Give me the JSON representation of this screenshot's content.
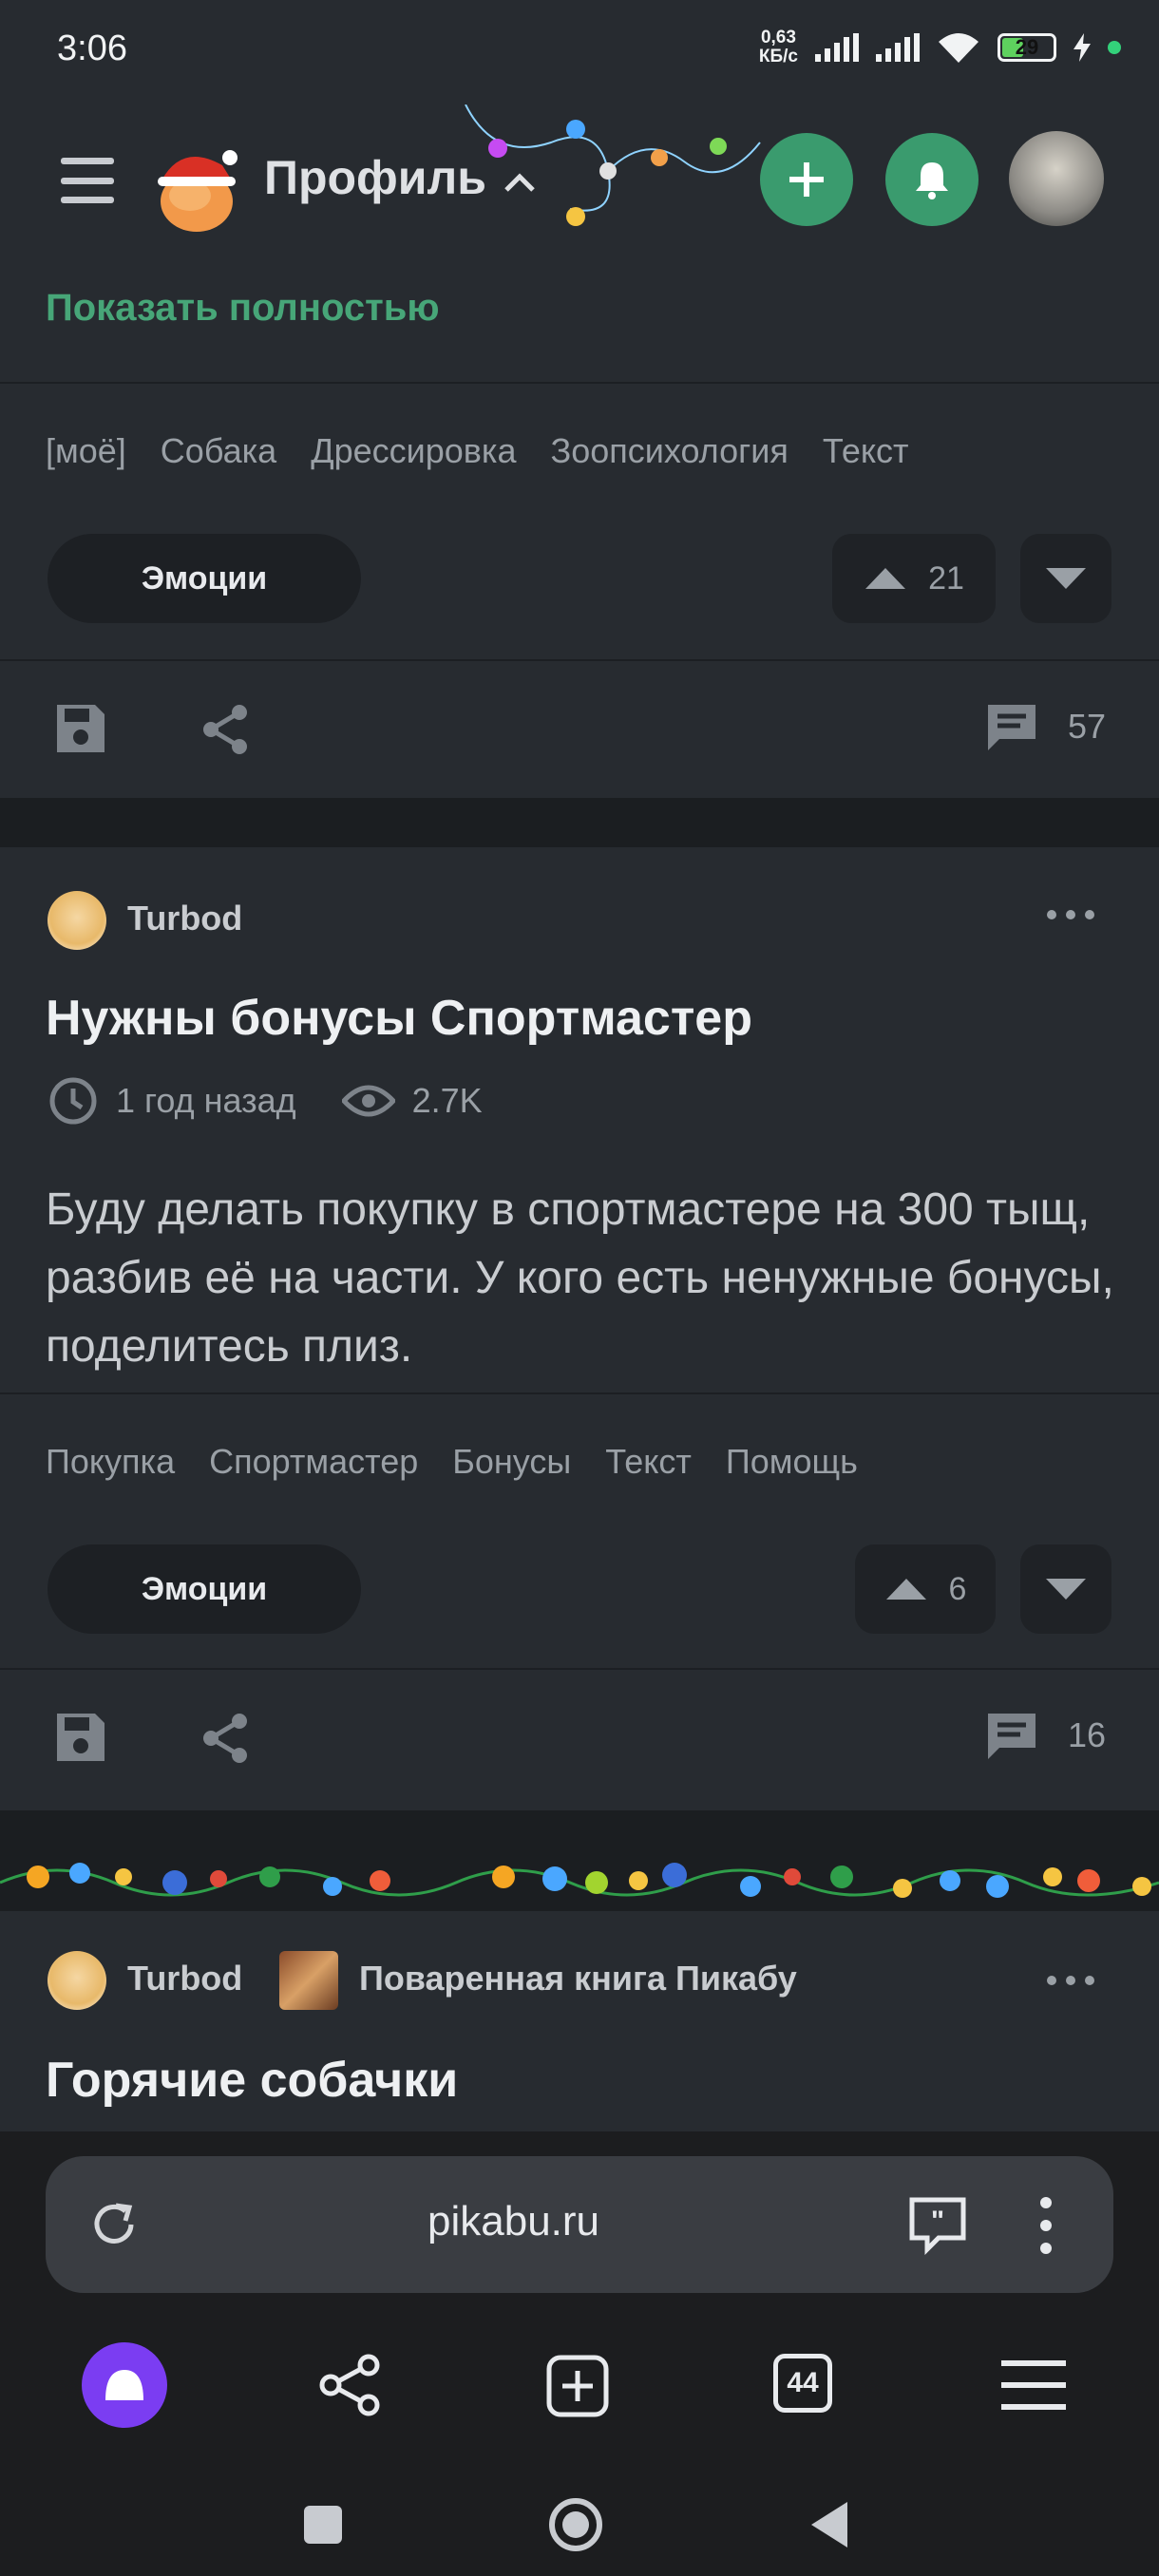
{
  "status_bar": {
    "time": "3:06",
    "net_speed_value": "0,63",
    "net_speed_unit": "КБ/с",
    "battery": "29"
  },
  "header": {
    "title": "Профиль",
    "icons": [
      "menu-icon",
      "chevron-up-icon",
      "plus-icon",
      "bell-icon"
    ]
  },
  "prev_post": {
    "show_full": "Показать полностью",
    "tags": [
      "[моё]",
      "Собака",
      "Дрессировка",
      "Зоопсихология",
      "Текст"
    ],
    "emotions_label": "Эмоции",
    "rating": "21",
    "comments": "57"
  },
  "post": {
    "author": "Turbod",
    "title": "Нужны бонусы Спортмастер",
    "time_ago": "1 год назад",
    "views": "2.7K",
    "body": "Буду делать покупку в спортмастере на 300 тыщ, разбив её на части. У кого есть ненужные бонусы, поделитесь плиз.",
    "tags": [
      "Покупка",
      "Спортмастер",
      "Бонусы",
      "Текст",
      "Помощь"
    ],
    "emotions_label": "Эмоции",
    "rating": "6",
    "comments": "16"
  },
  "next_post": {
    "author": "Turbod",
    "community": "Поваренная книга Пикабу",
    "title": "Горячие собачки"
  },
  "browser": {
    "url": "pikabu.ru",
    "tabs_count": "44"
  },
  "colors": {
    "accent_green": "#3a9b6e",
    "link_green": "#47a678",
    "background": "#22262b",
    "alice_purple": "#7b3df2"
  }
}
